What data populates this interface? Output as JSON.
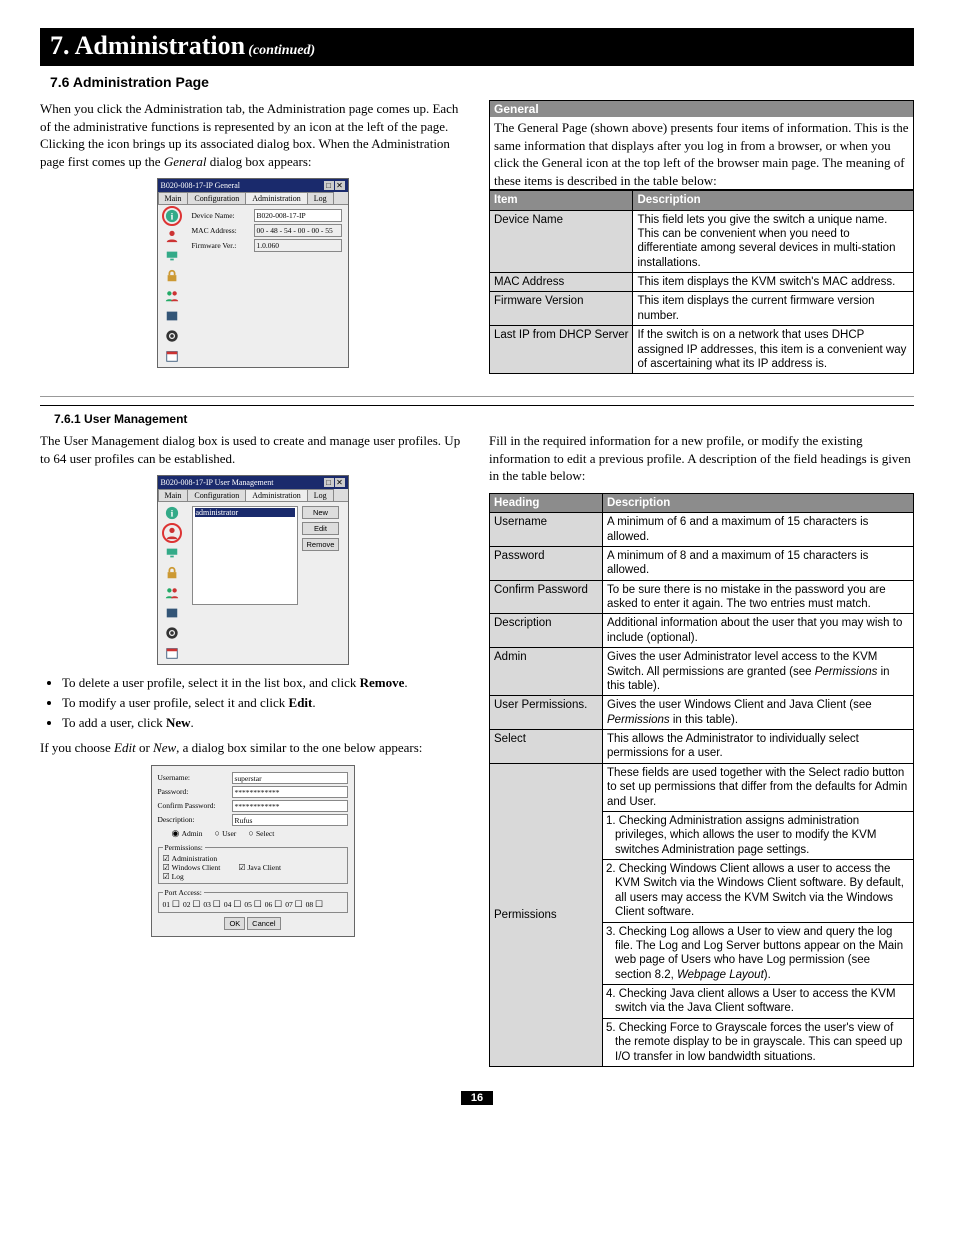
{
  "chapter": {
    "number": "7.",
    "title": "Administration",
    "continued": "(continued)"
  },
  "section_7_6": {
    "heading": "7.6 Administration Page",
    "intro": "When you click the Administration tab, the Administration page comes up. Each of the administrative functions is represented by an icon at the left of the page. Clicking the icon brings up its associated dialog box. When the Administration page first comes up the General dialog box appears:"
  },
  "general_box": {
    "label": "General",
    "blurb": "The General Page (shown above) presents four items of information. This is the same information that displays after you log in from a browser, or when you click the General icon at the top left of the browser main page. The meaning of these items is described in the table below:",
    "headers": [
      "Item",
      "Description"
    ],
    "rows": [
      [
        "Device Name",
        "This field lets you give the switch a unique name. This can be convenient when you need to differentiate among several devices in multi-station installations."
      ],
      [
        "MAC Address",
        "This item displays the KVM switch's MAC address."
      ],
      [
        "Firmware Version",
        "This item displays the current firmware version number."
      ],
      [
        "Last IP from DHCP Server",
        "If the switch is on a network that uses DHCP assigned IP addresses, this item is a convenient way of ascertaining what its IP address is."
      ]
    ]
  },
  "mock1": {
    "title": "B020-008-17-IP General",
    "tabs": [
      "Main",
      "Configuration",
      "Administration",
      "Log"
    ],
    "active_tab": 2,
    "fields": {
      "device_label": "Device Name:",
      "device_value": "B020-008-17-IP",
      "mac_label": "MAC Address:",
      "mac_value": "00 - 48 - 54 - 00 - 00 - 55",
      "fw_label": "Firmware Ver.:",
      "fw_value": "1.0.060"
    }
  },
  "section_7_6_1": {
    "heading": "7.6.1 User Management",
    "para_left": "The User Management dialog box is used to create and manage user profiles. Up to 64 user profiles can be established.",
    "bullets": [
      "To delete a user profile, select it in the list box, and click Remove.",
      "To modify a user profile, select it and click Edit.",
      "To add a user, click New."
    ],
    "bullets_keywords": [
      "Remove",
      "Edit",
      "New"
    ],
    "after_bullets": "If you choose Edit or New, a dialog box similar to the one below appears:",
    "para_right": "Fill in the required information for a new profile, or modify the existing information to edit a previous profile. A description of the field headings is given in the table below:"
  },
  "mock2": {
    "title": "B020-008-17-IP User Management",
    "tabs": [
      "Main",
      "Configuration",
      "Administration",
      "Log"
    ],
    "active_tab": 2,
    "list_item": "administrator",
    "buttons": [
      "New",
      "Edit",
      "Remove"
    ]
  },
  "mock3": {
    "title_prefix": "B020-008-17-IP User Management",
    "labels": {
      "username": "Username:",
      "password": "Password:",
      "confirm": "Confirm Password:",
      "desc": "Description:",
      "radios": [
        "Admin",
        "User",
        "Select"
      ],
      "perm_legend": "Permissions:",
      "perm_opts": [
        "Administration",
        "Windows Client",
        "Java Client",
        "Log"
      ],
      "port_legend": "Port Access:",
      "ports": [
        "01",
        "02",
        "03",
        "04",
        "05",
        "06",
        "07",
        "08"
      ],
      "ok": "OK",
      "cancel": "Cancel"
    },
    "values": {
      "username": "superstar",
      "password": "************",
      "confirm": "************",
      "desc": "Rufus"
    }
  },
  "headings_table": {
    "headers": [
      "Heading",
      "Description"
    ],
    "rows_simple": [
      [
        "Username",
        "A minimum of 6 and a maximum of 15 characters is allowed."
      ],
      [
        "Password",
        "A minimum of 8 and a maximum of 15 characters is allowed."
      ],
      [
        "Confirm Password",
        "To be sure there is no mistake in the password you are asked to enter it again. The two entries must match."
      ],
      [
        "Description",
        "Additional information about the user that you may wish to include (optional)."
      ],
      [
        "Admin",
        "Gives the user Administrator level access to the KVM Switch. All permissions are granted (see Permissions in this table)."
      ],
      [
        "User Permissions.",
        "Gives the user Windows Client and Java Client (see Permissions in this table)."
      ],
      [
        "Select",
        "This allows the Administrator to individually select permissions for a user."
      ]
    ],
    "perm_label": "Permissions",
    "perm_rows": [
      "These fields are used together with the Select radio button to set up permissions that differ from the defaults for Admin and User.",
      "1. Checking Administration assigns administration privileges, which allows the user to modify the KVM switches Administration page settings.",
      "2. Checking Windows Client allows a user to access the KVM Switch via the Windows Client software. By default, all users may access the KVM Switch via the Windows Client software.",
      "3. Checking Log allows a User to view and query the log file. The Log and Log Server buttons appear on the Main web page of Users who have Log permission (see section 8.2, Webpage Layout).",
      "4. Checking Java client allows a User to access the KVM switch via the Java Client software.",
      "5. Checking Force to Grayscale forces the user's view of the remote display to be in grayscale. This can speed up I/O transfer in low bandwidth situations."
    ]
  },
  "page_number": "16"
}
